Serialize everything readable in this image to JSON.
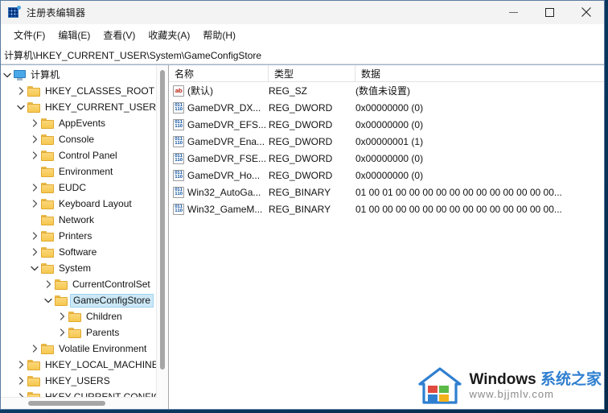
{
  "window": {
    "title": "注册表编辑器",
    "app_icon": "registry-editor-icon",
    "minimize_label": "最小化",
    "maximize_label": "最大化",
    "close_label": "关闭"
  },
  "menubar": {
    "items": [
      {
        "label": "文件(F)"
      },
      {
        "label": "编辑(E)"
      },
      {
        "label": "查看(V)"
      },
      {
        "label": "收藏夹(A)"
      },
      {
        "label": "帮助(H)"
      }
    ]
  },
  "address_bar": {
    "value": "计算机\\HKEY_CURRENT_USER\\System\\GameConfigStore"
  },
  "tree": {
    "nodes": [
      {
        "label": "计算机",
        "depth": 0,
        "state": "expanded",
        "icon": "computer-icon",
        "selected": false
      },
      {
        "label": "HKEY_CLASSES_ROOT",
        "depth": 1,
        "state": "collapsed",
        "icon": "folder-icon",
        "selected": false
      },
      {
        "label": "HKEY_CURRENT_USER",
        "depth": 1,
        "state": "expanded",
        "icon": "folder-icon",
        "selected": false
      },
      {
        "label": "AppEvents",
        "depth": 2,
        "state": "collapsed",
        "icon": "folder-icon",
        "selected": false
      },
      {
        "label": "Console",
        "depth": 2,
        "state": "collapsed",
        "icon": "folder-icon",
        "selected": false
      },
      {
        "label": "Control Panel",
        "depth": 2,
        "state": "collapsed",
        "icon": "folder-icon",
        "selected": false
      },
      {
        "label": "Environment",
        "depth": 2,
        "state": "leaf",
        "icon": "folder-icon",
        "selected": false
      },
      {
        "label": "EUDC",
        "depth": 2,
        "state": "collapsed",
        "icon": "folder-icon",
        "selected": false
      },
      {
        "label": "Keyboard Layout",
        "depth": 2,
        "state": "collapsed",
        "icon": "folder-icon",
        "selected": false
      },
      {
        "label": "Network",
        "depth": 2,
        "state": "leaf",
        "icon": "folder-icon",
        "selected": false
      },
      {
        "label": "Printers",
        "depth": 2,
        "state": "collapsed",
        "icon": "folder-icon",
        "selected": false
      },
      {
        "label": "Software",
        "depth": 2,
        "state": "collapsed",
        "icon": "folder-icon",
        "selected": false
      },
      {
        "label": "System",
        "depth": 2,
        "state": "expanded",
        "icon": "folder-icon",
        "selected": false
      },
      {
        "label": "CurrentControlSet",
        "depth": 3,
        "state": "collapsed",
        "icon": "folder-icon",
        "selected": false
      },
      {
        "label": "GameConfigStore",
        "depth": 3,
        "state": "expanded",
        "icon": "folder-icon",
        "selected": true
      },
      {
        "label": "Children",
        "depth": 4,
        "state": "collapsed",
        "icon": "folder-icon",
        "selected": false
      },
      {
        "label": "Parents",
        "depth": 4,
        "state": "collapsed",
        "icon": "folder-icon",
        "selected": false
      },
      {
        "label": "Volatile Environment",
        "depth": 2,
        "state": "collapsed",
        "icon": "folder-icon",
        "selected": false
      },
      {
        "label": "HKEY_LOCAL_MACHINE",
        "depth": 1,
        "state": "collapsed",
        "icon": "folder-icon",
        "selected": false
      },
      {
        "label": "HKEY_USERS",
        "depth": 1,
        "state": "collapsed",
        "icon": "folder-icon",
        "selected": false
      },
      {
        "label": "HKEY CURRENT CONFIG",
        "depth": 1,
        "state": "collapsed",
        "icon": "folder-icon",
        "selected": false
      }
    ]
  },
  "list": {
    "columns": [
      {
        "label": "名称"
      },
      {
        "label": "类型"
      },
      {
        "label": "数据"
      }
    ],
    "rows": [
      {
        "icon": "string-value-icon",
        "name": "(默认)",
        "type": "REG_SZ",
        "data": "(数值未设置)"
      },
      {
        "icon": "binary-value-icon",
        "name": "GameDVR_DX...",
        "type": "REG_DWORD",
        "data": "0x00000000 (0)"
      },
      {
        "icon": "binary-value-icon",
        "name": "GameDVR_EFS...",
        "type": "REG_DWORD",
        "data": "0x00000000 (0)"
      },
      {
        "icon": "binary-value-icon",
        "name": "GameDVR_Ena...",
        "type": "REG_DWORD",
        "data": "0x00000001 (1)"
      },
      {
        "icon": "binary-value-icon",
        "name": "GameDVR_FSE...",
        "type": "REG_DWORD",
        "data": "0x00000000 (0)"
      },
      {
        "icon": "binary-value-icon",
        "name": "GameDVR_Ho...",
        "type": "REG_DWORD",
        "data": "0x00000000 (0)"
      },
      {
        "icon": "binary-value-icon",
        "name": "Win32_AutoGa...",
        "type": "REG_BINARY",
        "data": "01 00 01 00 00 00 00 00 00 00 00 00 00 00 00..."
      },
      {
        "icon": "binary-value-icon",
        "name": "Win32_GameM...",
        "type": "REG_BINARY",
        "data": "01 00 00 00 00 00 00 00 00 00 00 00 00 00 00..."
      }
    ]
  },
  "watermark": {
    "brand_en": "Windows ",
    "brand_cn": "系统之家",
    "url": "www.bjjmlv.com",
    "accent_color": "#2f7fd0"
  }
}
